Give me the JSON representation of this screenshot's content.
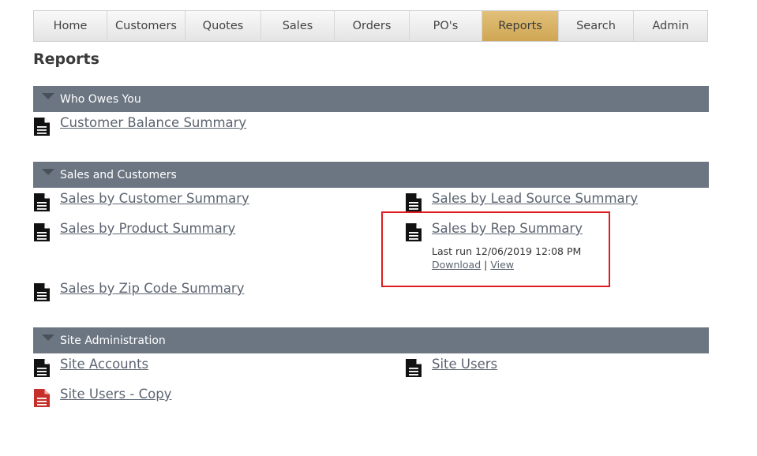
{
  "nav": {
    "tabs": [
      {
        "label": "Home"
      },
      {
        "label": "Customers"
      },
      {
        "label": "Quotes"
      },
      {
        "label": "Sales"
      },
      {
        "label": "Orders"
      },
      {
        "label": "PO's"
      },
      {
        "label": "Reports",
        "active": true
      },
      {
        "label": "Search"
      },
      {
        "label": "Admin"
      }
    ]
  },
  "page": {
    "title": "Reports"
  },
  "sections": {
    "who_owes_you": {
      "label": "Who Owes You",
      "reports": {
        "customer_balance": "Customer Balance Summary"
      }
    },
    "sales_customers": {
      "label": "Sales and Customers",
      "reports": {
        "by_customer": "Sales by Customer Summary",
        "by_lead_source": "Sales by Lead Source Summary",
        "by_product": "Sales by Product Summary",
        "by_rep": "Sales by Rep Summary",
        "by_zip": "Sales by Zip Code Summary"
      },
      "rep_summary_details": {
        "last_run": "Last run 12/06/2019 12:08 PM",
        "download_label": "Download",
        "separator": "|",
        "view_label": "View"
      }
    },
    "site_admin": {
      "label": "Site Administration",
      "reports": {
        "site_accounts": "Site Accounts",
        "site_users": "Site Users",
        "site_users_copy": "Site Users - Copy"
      }
    }
  },
  "colors": {
    "section_bar": "#6c7682",
    "active_tab": "#cfa653",
    "link": "#5b6470",
    "highlight": "#e01b22",
    "icon_default": "#111111",
    "icon_custom": "#c62f2a"
  }
}
